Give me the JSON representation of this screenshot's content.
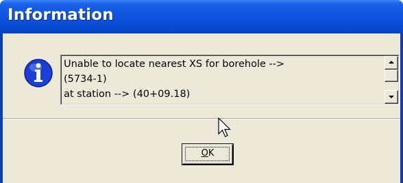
{
  "dialog": {
    "title": "Information",
    "icon": "information-icon",
    "message_lines": [
      "Unable to locate nearest XS for borehole -->",
      "(5734-1)",
      "at station --> (40+09.18)"
    ],
    "ok_button": {
      "mnemonic": "O",
      "rest": "K"
    }
  },
  "colors": {
    "titlebar": "#0b4bd6",
    "client": "#ece9d8",
    "icon": "#1a3fd6"
  }
}
